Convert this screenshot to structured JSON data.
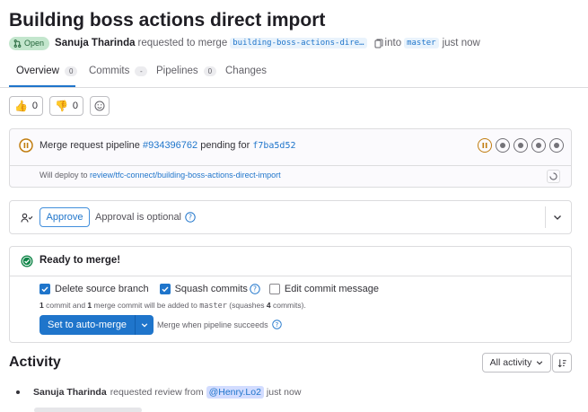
{
  "mr": {
    "title": "Building boss actions direct import",
    "status": "Open",
    "author": "Sanuja Tharinda",
    "requested_text": "requested to merge",
    "source_branch": "building-boss-actions-dire…",
    "into_text": "into",
    "target_branch": "master",
    "time": "just now"
  },
  "tabs": [
    {
      "label": "Overview",
      "count": "0"
    },
    {
      "label": "Commits",
      "count": "-"
    },
    {
      "label": "Pipelines",
      "count": "0"
    },
    {
      "label": "Changes",
      "count": ""
    }
  ],
  "reactions": {
    "thumbs_up": "0",
    "thumbs_down": "0"
  },
  "pipeline": {
    "prefix": "Merge request pipeline",
    "id": "#934396762",
    "status_text": "pending for",
    "sha": "f7ba5d52",
    "deploy_prefix": "Will deploy to",
    "deploy_target": "review/tfc-connect/building-boss-actions-direct-import"
  },
  "approval": {
    "button": "Approve",
    "text": "Approval is optional"
  },
  "merge": {
    "ready": "Ready to merge!",
    "options": [
      {
        "label": "Delete source branch",
        "checked": true
      },
      {
        "label": "Squash commits",
        "checked": true
      },
      {
        "label": "Edit commit message",
        "checked": false
      }
    ],
    "summary": {
      "n1": "1",
      "t1": "commit and",
      "n2": "1",
      "t2": "merge commit will be added to",
      "branch": "master",
      "t3": "(squashes",
      "n3": "4",
      "t4": "commits)."
    },
    "button": "Set to auto-merge",
    "when_text": "Merge when pipeline succeeds"
  },
  "activity": {
    "title": "Activity",
    "filter": "All activity",
    "note": {
      "author": "Sanuja Tharinda",
      "text": "requested review from",
      "mention": "@Henry.Lo2",
      "time": "just now"
    }
  },
  "colors": {
    "accent": "#1f75cb",
    "success": "#108548",
    "pending": "#c17d10"
  }
}
